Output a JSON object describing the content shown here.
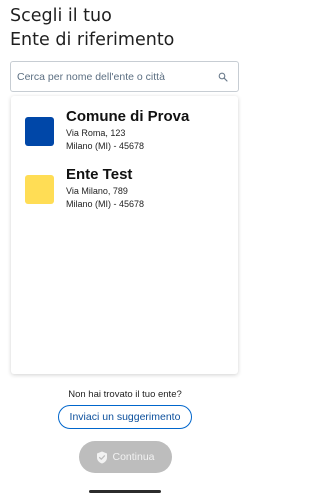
{
  "header": {
    "title_line1": "Scegli il tuo",
    "title_line2": "Ente di riferimento"
  },
  "search": {
    "placeholder": "Cerca per nome dell'ente o città",
    "icon": "search-icon"
  },
  "entities": [
    {
      "name": "Comune di Prova",
      "address_line1": "Via Roma, 123",
      "address_line2": "Milano (MI) - 45678",
      "color": "#0047a8"
    },
    {
      "name": "Ente Test",
      "address_line1": "Via Milano, 789",
      "address_line2": "Milano (MI) - 45678",
      "color": "#ffdd55"
    }
  ],
  "footer": {
    "not_found_text": "Non hai trovato il tuo ente?",
    "suggest_label": "Inviaci un suggerimento",
    "continue_label": "Continua",
    "continue_icon": "shield-check-icon"
  },
  "colors": {
    "primary": "#0066cc",
    "disabled_button": "#bdbdbd"
  }
}
